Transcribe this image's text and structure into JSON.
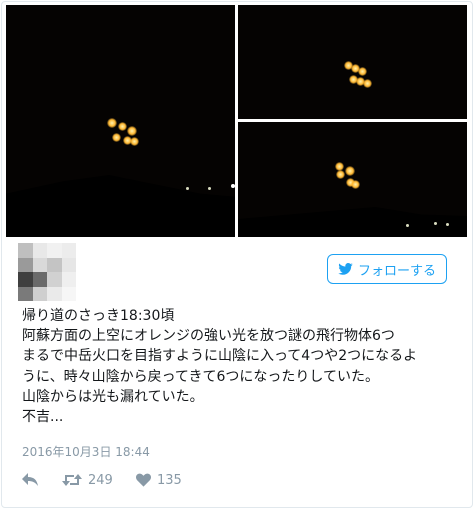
{
  "tweet": {
    "follow_label": "フォローする",
    "text_lines": [
      "帰り道のさっき18:30頃",
      "阿蘇方面の上空にオレンジの強い光を放つ謎の飛行物体6つ",
      "まるで中岳火口を目指すように山陰に入って4つや2つになるよ",
      "うに、時々山陰から戻ってきて6つになったりしていた。",
      "山陰からは光も漏れていた。",
      "不吉..."
    ],
    "timestamp": "2016年10月3日 18:44",
    "retweet_count": "249",
    "like_count": "135"
  },
  "icons": {
    "follow": "twitter-bird-icon",
    "reply": "reply-icon",
    "retweet": "retweet-icon",
    "like": "heart-icon"
  },
  "colors": {
    "accent": "#1da1f2",
    "muted": "#8899a6",
    "text": "#14171a",
    "light_glow": "#ffb833"
  }
}
